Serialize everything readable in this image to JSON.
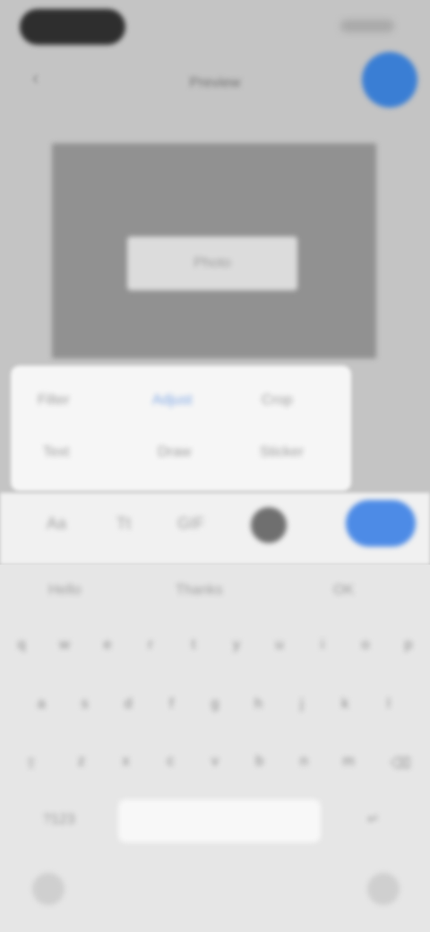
{
  "header": {
    "title": "Preview",
    "back_icon": "chevron-left-icon",
    "fab_icon": "plus-icon",
    "fab_color": "#3a7ed4"
  },
  "media": {
    "label": "Photo"
  },
  "options": {
    "row1": [
      "Filter",
      "Adjust",
      "Crop"
    ],
    "row2": [
      "Text",
      "Draw",
      "Sticker"
    ],
    "selected": "Adjust",
    "accent": "#7ea6e4"
  },
  "actions": {
    "a1": "Aa",
    "a2": "Tt",
    "a3": "GIF",
    "send_color": "#4d8be6"
  },
  "keyboard": {
    "suggestions": [
      "Hello",
      "Thanks",
      "OK"
    ],
    "row1": [
      "q",
      "w",
      "e",
      "r",
      "t",
      "y",
      "u",
      "i",
      "o",
      "p"
    ],
    "row2": [
      "a",
      "s",
      "d",
      "f",
      "g",
      "h",
      "j",
      "k",
      "l"
    ],
    "row3": [
      "z",
      "x",
      "c",
      "v",
      "b",
      "n",
      "m"
    ],
    "shift": "⇧",
    "backspace": "⌫",
    "numbers": "?123",
    "return": "↵"
  }
}
